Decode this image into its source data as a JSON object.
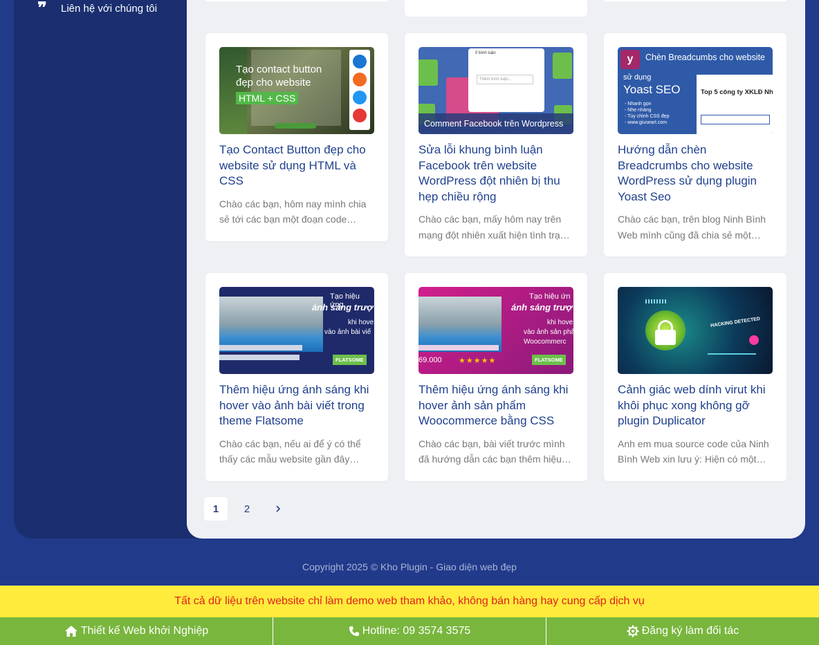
{
  "sidebar": {
    "items": [
      {
        "label": "Liên hệ với chúng tôi",
        "icon": "quote-icon"
      }
    ]
  },
  "posts": [
    {
      "title": "Tạo Contact Button đẹp cho website sử dụng HTML và CSS",
      "excerpt": "Chào các bạn, hôm nay mình chia sẻ tới các bạn một đoạn code…",
      "thumb": {
        "line1": "Tạo contact button",
        "line2": "đẹp cho website",
        "badge": "HTML + CSS"
      }
    },
    {
      "title": "Sửa lỗi khung bình luận Facebook trên website WordPress đột nhiên bị thu hẹp chiều rộng",
      "excerpt": "Chào các bạn, mấy hôm nay trên mạng đột nhiên xuất hiện tình trạ…",
      "thumb": {
        "caption": "Comment Facebook trên Wordpress",
        "box_title": "0 bình luận",
        "box_input": "Thêm bình luận..."
      }
    },
    {
      "title": "Hướng dẫn chèn Breadcrumbs cho website WordPress sử dụng plugin Yoast Seo",
      "excerpt": "Chào các bạn, trên blog Ninh Bình Web mình cũng đã chia sẻ một…",
      "thumb": {
        "header": "Chèn Breadcumbs cho website",
        "sub": "sử dụng",
        "big": "Yoast SEO",
        "panel": "Top 5 công ty XKLĐ Nhậ",
        "bullets": [
          "- Nhanh gọn",
          "- Nhẹ nhàng",
          "- Tùy chỉnh CSS đẹp",
          "- www.giuseart.com"
        ]
      }
    },
    {
      "title": "Thêm hiệu ứng ánh sáng khi hover vào ảnh bài viết trong theme Flatsome",
      "excerpt": "Chào các bạn, nếu ai để ý có thể thấy các mẫu website gần đây…",
      "thumb": {
        "l1": "Tạo hiệu ứng",
        "l2": "ánh sáng trượ",
        "l3": "khi hove",
        "l4": "vào ảnh bài viế",
        "brand": "FLATSOME"
      }
    },
    {
      "title": "Thêm hiệu ứng ánh sáng khi hover ảnh sản phẩm Woocommerce bằng CSS",
      "excerpt": "Chào các bạn, bài viết trước mình đã hướng dẫn các bạn thêm hiệu…",
      "thumb": {
        "l1": "Tạo hiệu ứn",
        "l2": "ánh sáng trượ",
        "l3": "khi hove",
        "l4": "vào ảnh sản phẩ",
        "l5": "Woocommerc",
        "price": "69.000",
        "brand": "FLATSOME"
      }
    },
    {
      "title": "Cảnh giác web dính virut khi khôi phục xong không gỡ plugin Duplicator",
      "excerpt": "Anh em mua source code của Ninh Bình Web xin lưu ý: Hiện có một…",
      "thumb": {
        "label": "HACKING DETECTED"
      }
    }
  ],
  "pagination": {
    "pages": [
      "1",
      "2"
    ],
    "current": "1",
    "next_icon": "chevron-right-icon"
  },
  "footer": {
    "copyright": "Copyright 2025 © Kho Plugin - Giao diện web đẹp",
    "notice": "Tất cả dữ liệu trên website chỉ làm demo web tham khảo, không bán hàng hay cung cấp dịch vụ"
  },
  "bottombar": {
    "items": [
      {
        "label": "Thiết kế Web khởi Nghiệp",
        "icon": "home-icon"
      },
      {
        "label": "Hotline: 09 3574 3575",
        "icon": "phone-icon"
      },
      {
        "label": "Đăng ký làm đối tác",
        "icon": "gear-icon"
      }
    ]
  },
  "colors": {
    "page_bg": "#213a8a",
    "sidebar_bg": "#1a2e70",
    "title": "#20418e",
    "notice_bg": "#ffeb3b",
    "notice_text": "#e0201e",
    "bar_bg": "#79b63d"
  }
}
